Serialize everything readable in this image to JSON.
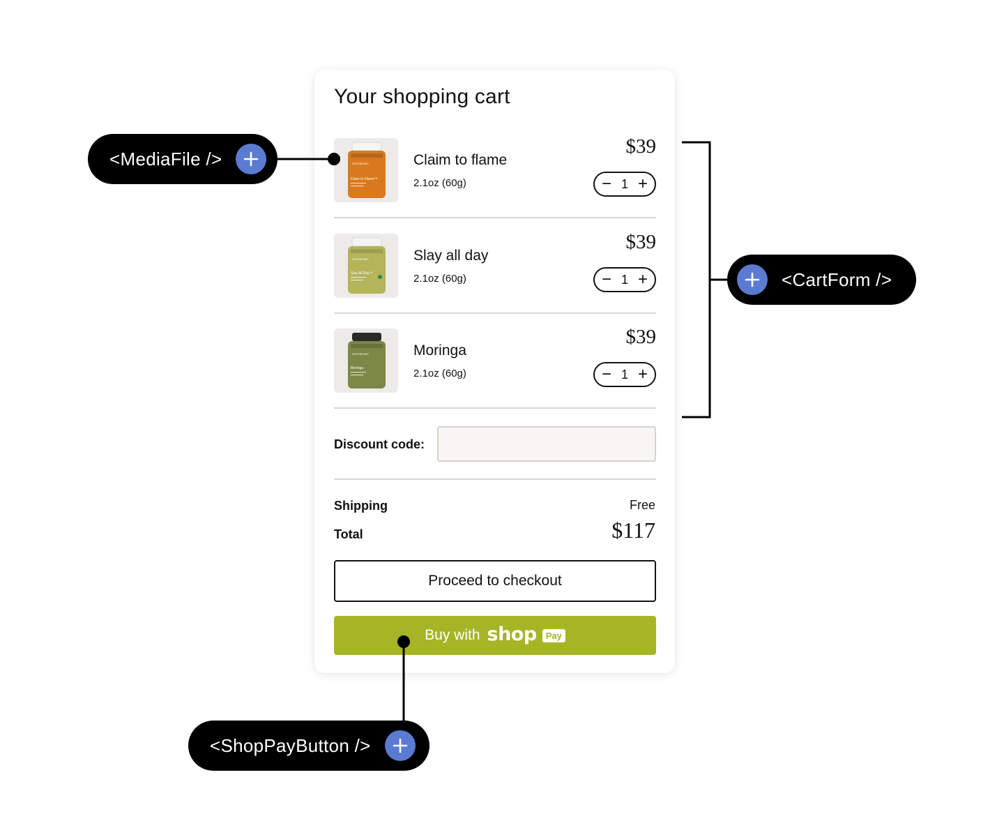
{
  "colors": {
    "accent_blue": "#5b7bd2",
    "shoppay_green": "#a5b526",
    "pill_black": "#000000"
  },
  "cart": {
    "title": "Your shopping cart",
    "items": [
      {
        "name": "Claim to flame",
        "size": "2.1oz (60g)",
        "price": "$39",
        "quantity": "1",
        "jar_color": "#d9791e",
        "jar_label": "Claim to Flame™"
      },
      {
        "name": "Slay all day",
        "size": "2.1oz (60g)",
        "price": "$39",
        "quantity": "1",
        "jar_color": "#b4b45a",
        "jar_label": "Slay All Day™"
      },
      {
        "name": "Moringa",
        "size": "2.1oz (60g)",
        "price": "$39",
        "quantity": "1",
        "jar_color": "#7d8746",
        "jar_label": "Moringa"
      }
    ],
    "qty_minus": "−",
    "qty_plus": "+",
    "jar_brand": "APOTHEKARY",
    "discount": {
      "label": "Discount code:",
      "value": "",
      "placeholder": ""
    },
    "shipping": {
      "label": "Shipping",
      "value": "Free"
    },
    "total": {
      "label": "Total",
      "value": "$117"
    },
    "checkout_label": "Proceed to checkout",
    "shoppay": {
      "label": "Buy with",
      "wordmark": "shop",
      "badge": "Pay"
    }
  },
  "annotations": {
    "media_file": {
      "label": "<MediaFile />",
      "icon": "plus-icon"
    },
    "cart_form": {
      "label": "<CartForm />",
      "icon": "plus-icon"
    },
    "shop_pay_button": {
      "label": "<ShopPayButton />",
      "icon": "plus-icon"
    }
  }
}
